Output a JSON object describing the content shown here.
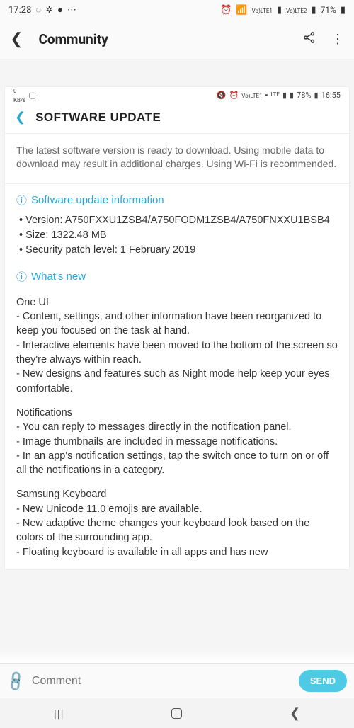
{
  "outer_status": {
    "time": "17:28",
    "battery": "71%",
    "sim1": "LTE1",
    "sim2": "LTE2",
    "vo": "Vo)"
  },
  "app_bar": {
    "title": "Community"
  },
  "inner_status": {
    "speed_value": "0",
    "speed_unit": "KB/s",
    "lte": "LTE",
    "battery": "78%",
    "time": "16:55",
    "sim": "LTE1",
    "vo": "Vo)"
  },
  "update_header": {
    "title": "SOFTWARE UPDATE"
  },
  "notice": "The latest software version is ready to download. Using mobile data to download may result in additional charges. Using Wi-Fi is recommended.",
  "info_section": {
    "heading": "Software update information",
    "version_label": "Version: A750FXXU1ZSB4/A750FODM1ZSB4/A750FNXXU1BSB4",
    "size_label": "Size: 1322.48 MB",
    "security_label": "Security patch level: 1 February 2019"
  },
  "whats_new": {
    "heading": "What's new",
    "groups": [
      {
        "title": "One UI",
        "lines": [
          "- Content, settings, and other information have been reorganized to keep you focused on the task at hand.",
          "- Interactive elements have been moved to the bottom of the screen so they're always within reach.",
          "- New designs and features such as Night mode help keep your eyes comfortable."
        ]
      },
      {
        "title": "Notifications",
        "lines": [
          "- You can reply to messages directly in the notification panel.",
          "- Image thumbnails are included in message notifications.",
          "- In an app's notification settings, tap the switch once to turn on or off all the notifications in a category."
        ]
      },
      {
        "title": "Samsung Keyboard",
        "lines": [
          "- New Unicode 11.0 emojis are available.",
          "- New adaptive theme changes your keyboard look based on the colors of the surrounding app.",
          "- Floating keyboard is available in all apps and has new"
        ]
      }
    ]
  },
  "comment": {
    "placeholder": "Comment",
    "send": "SEND"
  }
}
